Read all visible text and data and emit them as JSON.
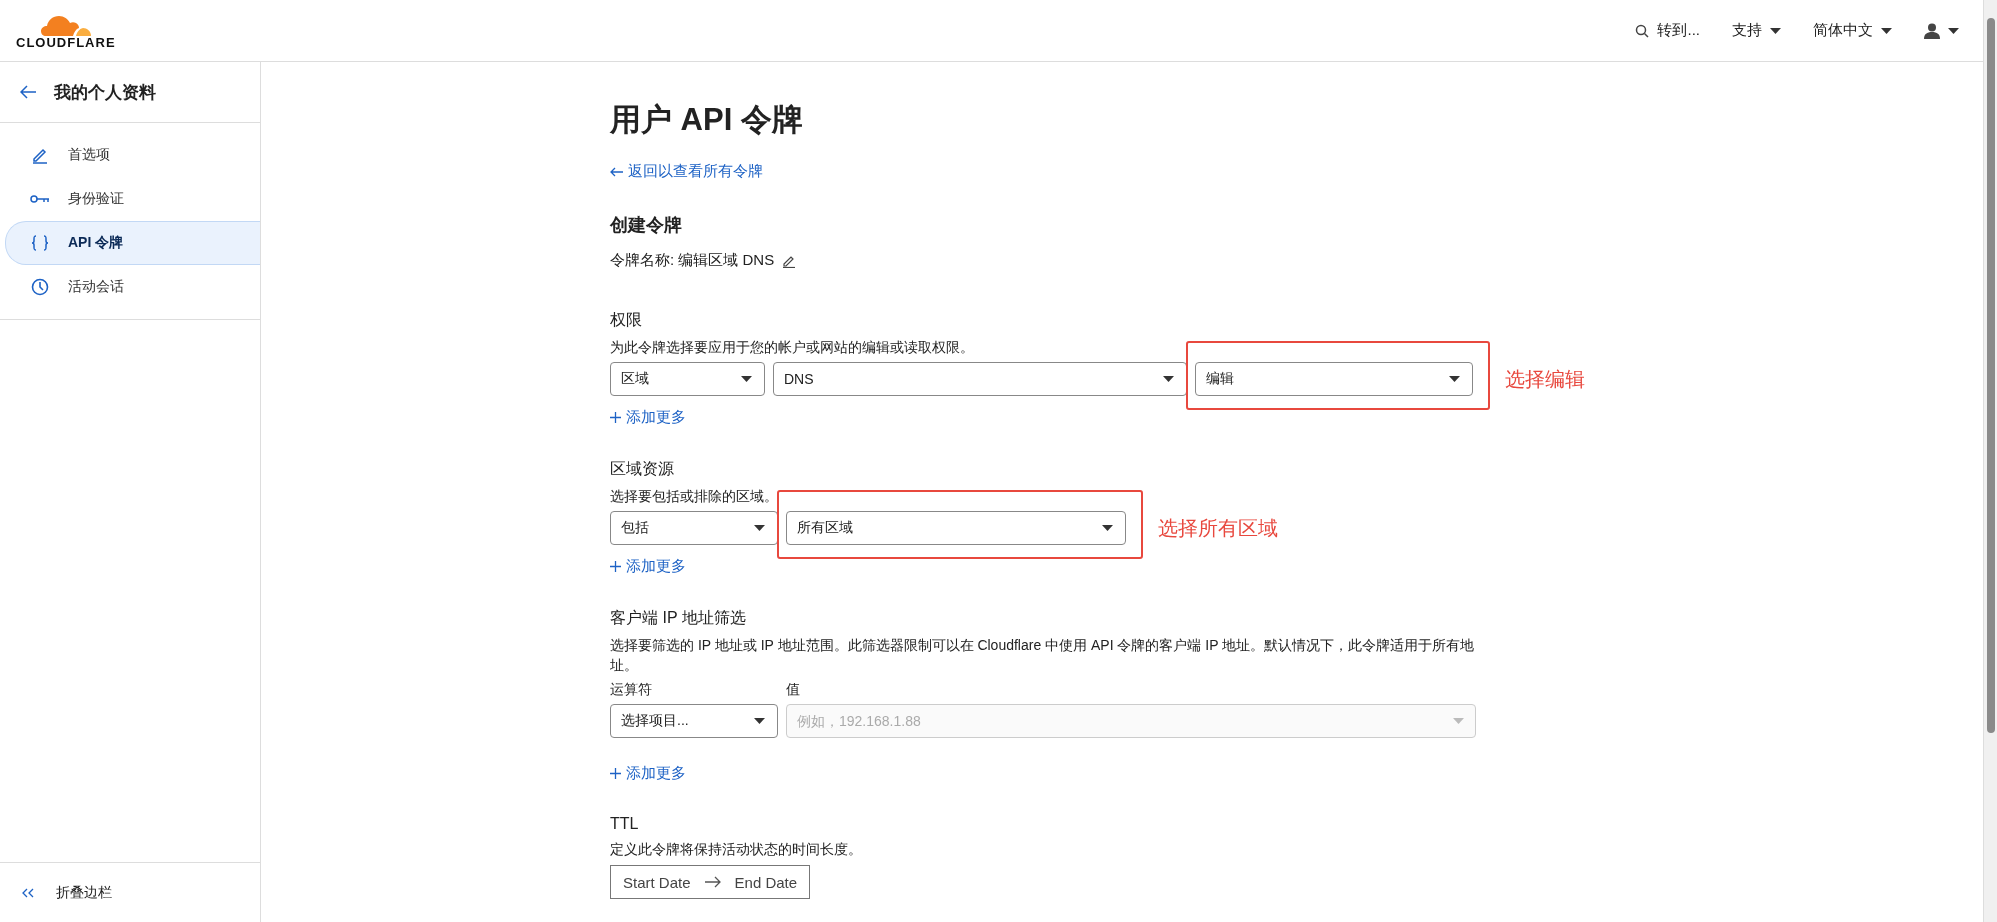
{
  "header": {
    "logo_text": "CLOUDFLARE",
    "nav": [
      {
        "kind": "search",
        "label": "转到..."
      },
      {
        "kind": "menu",
        "label": "支持"
      },
      {
        "kind": "menu",
        "label": "简体中文"
      },
      {
        "kind": "user"
      }
    ]
  },
  "sidebar": {
    "title": "我的个人资料",
    "items": [
      {
        "label": "首选项",
        "selected": false
      },
      {
        "label": "身份验证",
        "selected": false
      },
      {
        "label": "API 令牌",
        "selected": true
      },
      {
        "label": "活动会话",
        "selected": false
      }
    ],
    "collapse": "折叠边栏"
  },
  "main": {
    "title": "用户 API 令牌",
    "back_link": "返回以查看所有令牌",
    "section_title": "创建令牌",
    "token_name": "令牌名称: 编辑区域 DNS",
    "sections": [
      {
        "kind": "selects",
        "label": "权限",
        "description": "为此令牌选择要应用于您的帐户或网站的编辑或读取权限。",
        "selects": [
          {
            "value": "区域"
          },
          {
            "value": "DNS"
          },
          {
            "value": "编辑",
            "annotation": "选择编辑"
          }
        ],
        "add_more": "添加更多"
      },
      {
        "kind": "selects",
        "label": "区域资源",
        "description": "选择要包括或排除的区域。",
        "selects": [
          {
            "value": "包括"
          },
          {
            "value": "所有区域",
            "annotation": "选择所有区域"
          }
        ],
        "add_more": "添加更多"
      },
      {
        "kind": "ip_filter",
        "label": "客户端 IP 地址筛选",
        "description": "选择要筛选的 IP 地址或 IP 地址范围。此筛选器限制可以在 Cloudflare 中使用 API 令牌的客户端 IP 地址。默认情况下，此令牌适用于所有地址。",
        "operator_label": "运算符",
        "operator_value": "选择项目...",
        "value_label": "值",
        "value_placeholder": "例如，192.168.1.88",
        "add_more": "添加更多"
      },
      {
        "kind": "date_range",
        "label": "TTL",
        "description": "定义此令牌将保持活动状态的时间长度。",
        "start": "Start Date",
        "end": "End Date"
      }
    ]
  }
}
